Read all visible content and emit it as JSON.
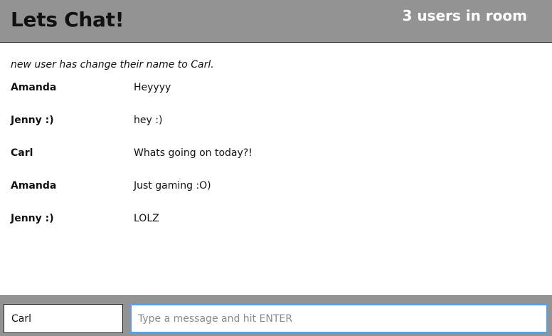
{
  "header": {
    "title": "Lets Chat!",
    "user_count": "3 users in room"
  },
  "chat": {
    "notice": "new user has change their name to Carl.",
    "messages": [
      {
        "user": "Amanda",
        "text": "Heyyyy"
      },
      {
        "user": "Jenny :)",
        "text": "hey :)"
      },
      {
        "user": "Carl",
        "text": "Whats going on today?!"
      },
      {
        "user": "Amanda",
        "text": "Just gaming :O)"
      },
      {
        "user": "Jenny :)",
        "text": "LOLZ"
      }
    ]
  },
  "footer": {
    "name_value": "Carl",
    "message_placeholder": "Type a message and hit ENTER"
  }
}
